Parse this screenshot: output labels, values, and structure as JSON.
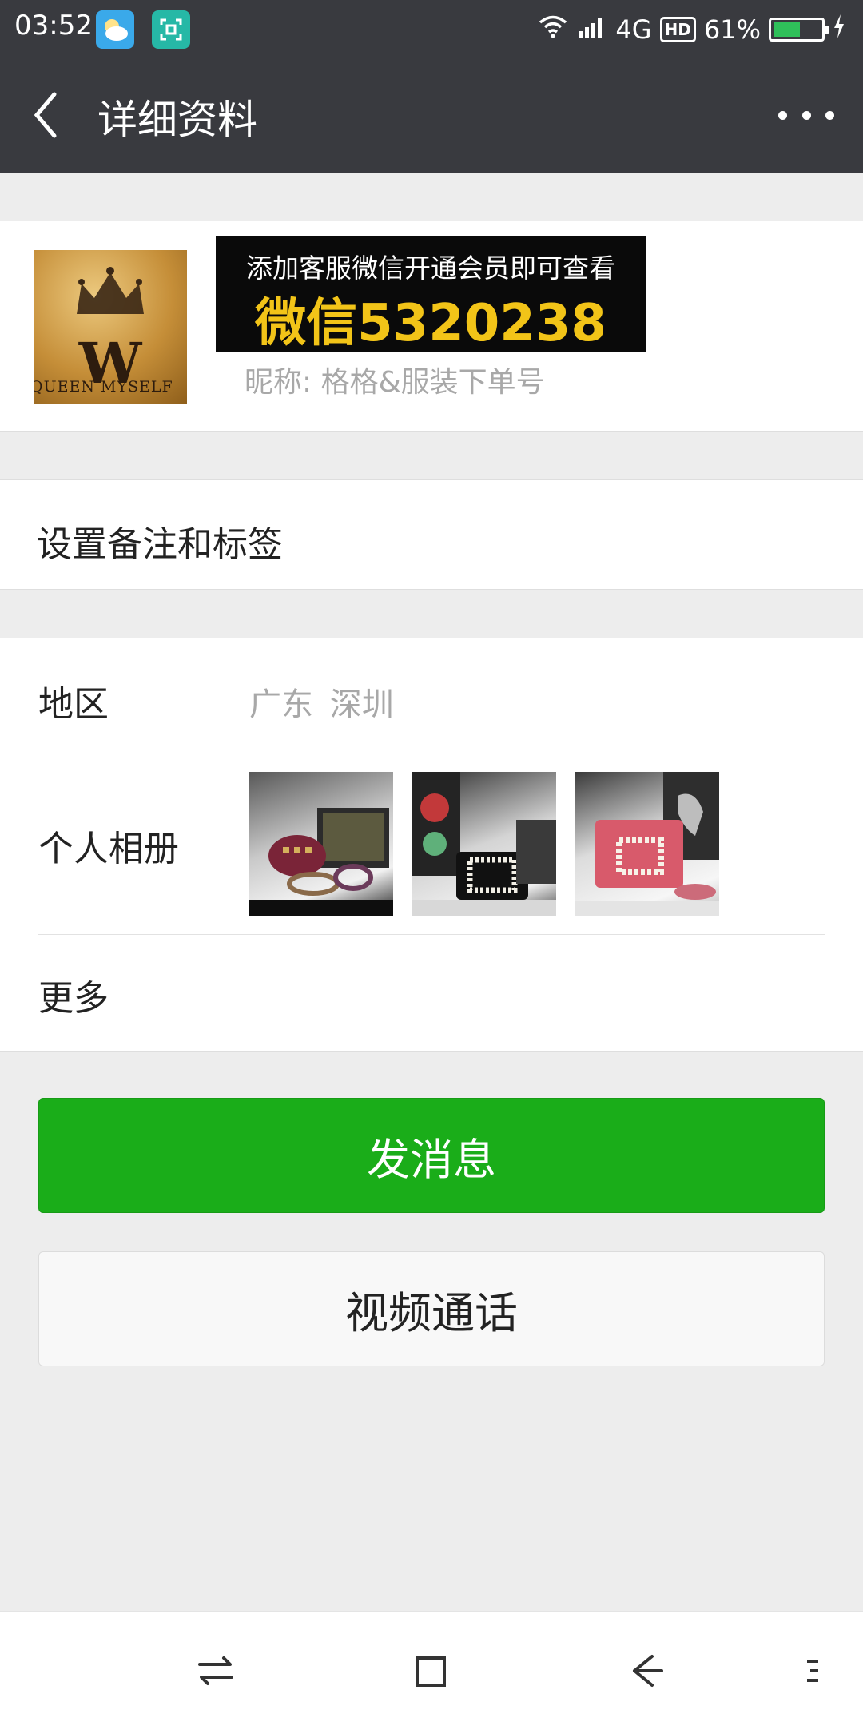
{
  "status_bar": {
    "time": "03:52",
    "network": "4G",
    "hd": "HD",
    "battery": "61%",
    "battery_level": 0.61,
    "icons": [
      "weather-app-icon",
      "scanner-app-icon",
      "wifi-icon",
      "signal-icon",
      "battery-icon",
      "charging-icon"
    ]
  },
  "header": {
    "title": "详细资料",
    "back_icon": "chevron-left-icon",
    "more_icon": "more-dots-icon"
  },
  "profile": {
    "avatar": {
      "monogram": "W",
      "brand_text": "QUEEN MYSELF"
    },
    "banner": {
      "line1": "添加客服微信开通会员即可查看",
      "line2": "微信5320238"
    },
    "nickname_label": "昵称:",
    "nickname_value": "格格&服装下单号"
  },
  "remark": {
    "label": "设置备注和标签"
  },
  "info": {
    "region_label": "地区",
    "region_value": "广东  深圳",
    "album_label": "个人相册",
    "album_photos": [
      "photo-bag-belts",
      "photo-bag-pearl-black",
      "photo-bag-pearl-pink"
    ],
    "more_label": "更多"
  },
  "buttons": {
    "message": "发消息",
    "video_call": "视频通话"
  },
  "nav_bar": {
    "icons": [
      "switch-apps-icon",
      "home-square-icon",
      "back-arrow-icon",
      "menu-dots-icon"
    ]
  },
  "colors": {
    "title_bar": "#393a3f",
    "primary_green": "#1aad19",
    "background": "#ededed",
    "banner_highlight": "#f2c418"
  }
}
